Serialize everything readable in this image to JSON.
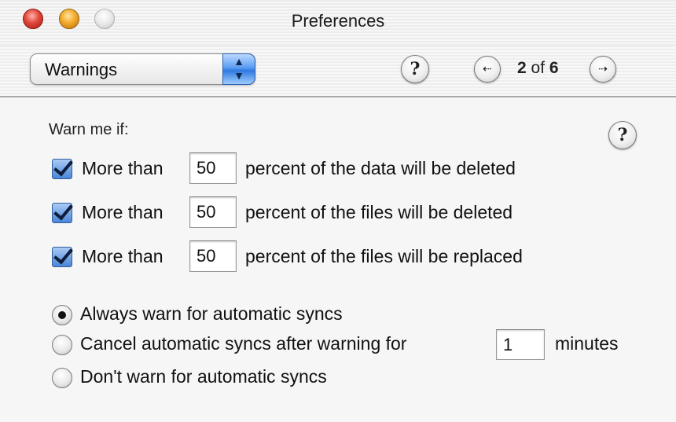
{
  "window": {
    "title": "Preferences"
  },
  "toolbar": {
    "popup_value": "Warnings",
    "help_label": "?",
    "pager": {
      "current": "2",
      "of": "of",
      "total": "6",
      "prev_glyph": "⇠",
      "next_glyph": "⇢"
    }
  },
  "content": {
    "heading": "Warn me if:",
    "help_label": "?",
    "thresholds": [
      {
        "checked": true,
        "prefix": "More than",
        "value": "50",
        "suffix": "percent of the data will be deleted"
      },
      {
        "checked": true,
        "prefix": "More than",
        "value": "50",
        "suffix": "percent of the files will be deleted"
      },
      {
        "checked": true,
        "prefix": "More than",
        "value": "50",
        "suffix": "percent of the files will be replaced"
      }
    ],
    "sync_options": [
      {
        "selected": true,
        "label": "Always warn for automatic syncs"
      },
      {
        "selected": false,
        "label": "Cancel automatic syncs after warning for",
        "minutes_value": "1",
        "minutes_label": "minutes"
      },
      {
        "selected": false,
        "label": "Don't warn for automatic syncs"
      }
    ]
  },
  "colors": {
    "checkbox_fill": "#4b86d8",
    "popup_accent": "#2f79e0",
    "close_button": "#e0443a",
    "minimize_button": "#f2a92a"
  }
}
